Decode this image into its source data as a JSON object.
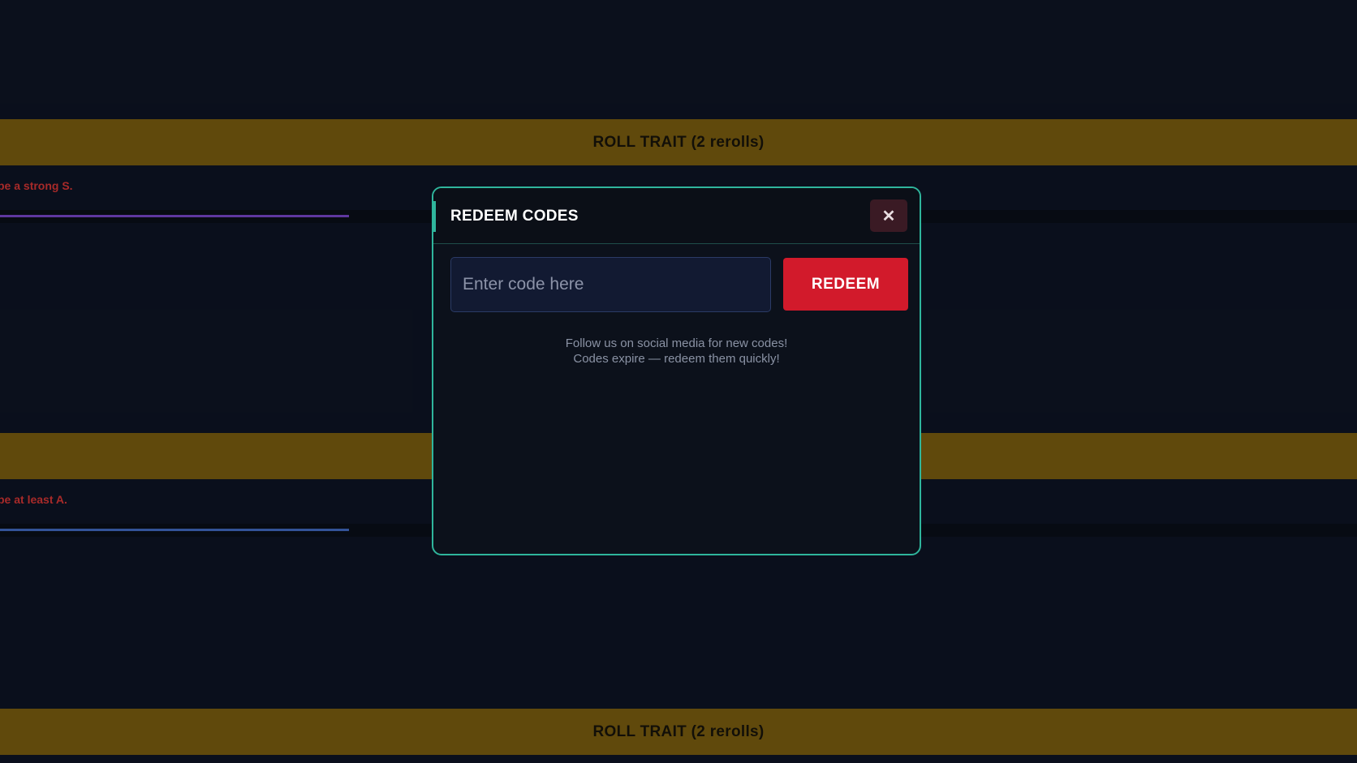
{
  "background": {
    "roll_bar_top": {
      "label": "ROLL TRAIT  (2 rerolls)"
    },
    "requirement_1": "be a strong S.",
    "roll_bar_middle": {
      "label": ""
    },
    "requirement_2": "be at least A.",
    "roll_bar_bottom": {
      "label": "ROLL TRAIT  (2 rerolls)"
    }
  },
  "modal": {
    "title": "REDEEM CODES",
    "close_label": "✕",
    "input": {
      "placeholder": "Enter code here",
      "value": ""
    },
    "redeem_label": "REDEEM",
    "info_line_1": "Follow us on social media for new codes!",
    "info_line_2": "Codes expire — redeem them quickly!"
  },
  "colors": {
    "accent": "#2fb59c",
    "redeem": "#d21a2b",
    "roll_bar": "#6e540e",
    "requirement_text": "#c0302f"
  }
}
